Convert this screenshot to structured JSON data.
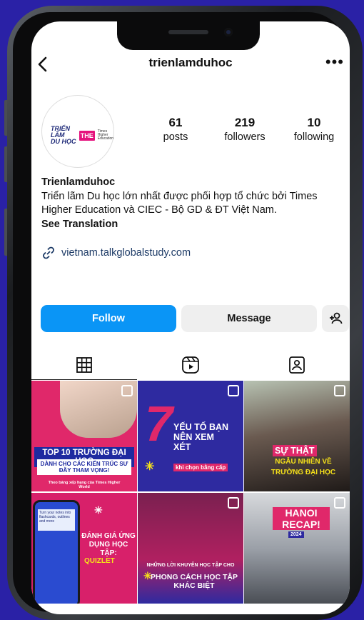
{
  "profile": {
    "username": "trienlamduhoc",
    "display_name": "Trienlamduhoc",
    "bio_line1": "Triển lãm Du học lớn nhất được phối hợp tổ chức bởi Times",
    "bio_line2": "Higher Education và CIEC - Bộ GD & ĐT Việt Nam.",
    "see_translation": "See Translation",
    "link": "vietnam.talkglobalstudy.com",
    "avatar_logo": {
      "line1": "TRIỂN LÃM",
      "line2": "DU HỌC",
      "the": "THE",
      "times": "Times Higher Education"
    }
  },
  "stats": [
    {
      "value": "61",
      "label": "posts"
    },
    {
      "value": "219",
      "label": "followers"
    },
    {
      "value": "10",
      "label": "following"
    }
  ],
  "buttons": {
    "follow": "Follow",
    "message": "Message"
  },
  "icons": {
    "back": "chevron-left-icon",
    "more": "more-dots-icon",
    "link": "link-icon",
    "add_user": "add-user-icon",
    "grid": "grid-icon",
    "reels": "reels-icon",
    "tagged": "tagged-icon"
  },
  "posts": [
    {
      "title": "TOP 10 TRƯỜNG ĐẠI HỌC",
      "subtitle": "DÀNH CHO CÁC KIẾN TRÚC SƯ ĐẦY THAM VỌNG!",
      "note": "Theo bảng xếp hạng của Times Higher World",
      "bg": "#e0286a"
    },
    {
      "title": "7",
      "subtitle": "YẾU TỐ BẠN NÊN XEM XÉT",
      "note": "khi chọn bằng cấp",
      "bg": "#2e2aa0"
    },
    {
      "title": "SỰ THẬT",
      "subtitle": "NGẪU NHIÊN VỀ TRƯỜNG ĐẠI HỌC",
      "note": "",
      "bg": "#6a5a50"
    },
    {
      "title": "ĐÁNH GIÁ ỨNG DỤNG HỌC TẬP:",
      "subtitle": "QUIZLET",
      "note": "Turn your notes into flashcards, outlines and more",
      "bg": "#d8206a"
    },
    {
      "title": "NHỮNG LỜI KHUYÊN HỌC TẬP CHO",
      "subtitle": "PHONG CÁCH HỌC TẬP KHÁC BIỆT",
      "note": "",
      "bg": "#b02060"
    },
    {
      "title": "HANOI RECAP!",
      "subtitle": "2024",
      "note": "",
      "bg": "#9ba0a8"
    }
  ]
}
